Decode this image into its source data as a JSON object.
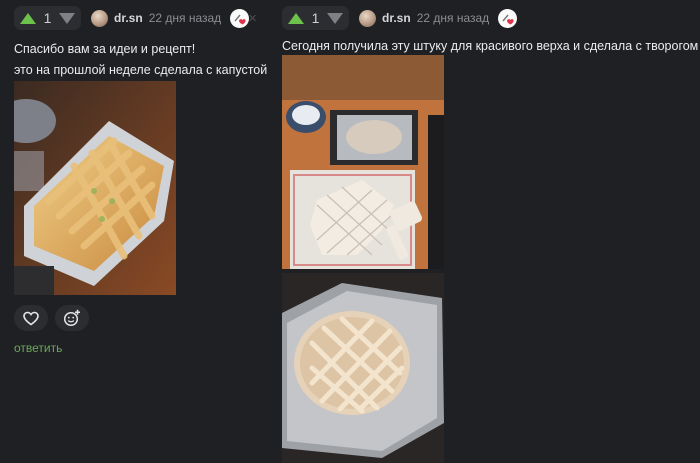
{
  "comments": [
    {
      "votes": 1,
      "username": "dr.sn",
      "time": "22 дня назад",
      "lines": [
        "Спасибо вам за идеи и рецепт!",
        "это на прошлой неделе сделала с капустой"
      ],
      "reply_label": "ответить"
    },
    {
      "votes": 1,
      "username": "dr.sn",
      "time": "22 дня назад",
      "lines": [
        "Сегодня получила эту штуку для красивого верха и сделала с творогом"
      ]
    }
  ],
  "colors": {
    "background": "#1f2023",
    "upvote": "#6cc24a",
    "downvote": "#7f8086",
    "reply": "#6ba85a"
  },
  "icons": [
    "arrow-up-icon",
    "arrow-down-icon",
    "avatar",
    "badge-icon",
    "heart-icon",
    "emoji-add-icon"
  ]
}
